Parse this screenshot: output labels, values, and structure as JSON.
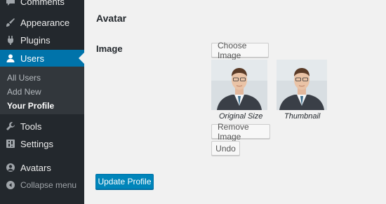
{
  "sidebar": {
    "items": [
      {
        "label": "Comments",
        "icon": "comments-icon"
      },
      {
        "label": "Appearance",
        "icon": "paintbrush-icon"
      },
      {
        "label": "Plugins",
        "icon": "plugin-icon"
      },
      {
        "label": "Users",
        "icon": "user-icon"
      },
      {
        "label": "Tools",
        "icon": "wrench-icon"
      },
      {
        "label": "Settings",
        "icon": "settings-icon"
      },
      {
        "label": "Avatars",
        "icon": "avatar-icon"
      },
      {
        "label": "Collapse menu",
        "icon": "collapse-icon"
      }
    ],
    "submenu": [
      {
        "label": "All Users"
      },
      {
        "label": "Add New"
      },
      {
        "label": "Your Profile"
      }
    ]
  },
  "main": {
    "heading": "Avatar",
    "field_label": "Image",
    "choose_button": "Choose Image",
    "original_caption": "Original Size",
    "thumbnail_caption": "Thumbnail",
    "remove_button": "Remove Image",
    "undo_button": "Undo",
    "update_button": "Update Profile"
  },
  "colors": {
    "sidebar_bg": "#23282d",
    "submenu_bg": "#32373c",
    "active_bg": "#0073aa",
    "primary_button": "#0085ba"
  }
}
